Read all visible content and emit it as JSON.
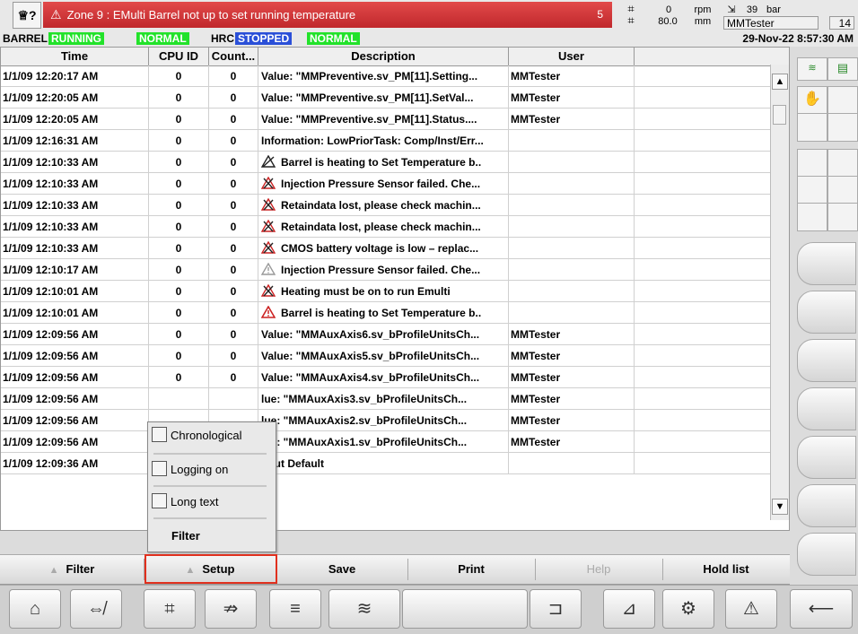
{
  "alarm": {
    "user_icon": "♕?",
    "text": "Zone 9 : EMulti Barrel not up to set running temperature",
    "count": "5"
  },
  "top_right": {
    "val1": "0",
    "val2": "80.0",
    "rpm": "rpm",
    "mm": "mm",
    "press_val": "39",
    "bar": "bar",
    "user": "MMTester",
    "num": "14"
  },
  "status": {
    "barrel": "BARREL",
    "running": "RUNNING",
    "normal1": "NORMAL",
    "hrc": "HRC",
    "stopped": "STOPPED",
    "normal2": "NORMAL",
    "datetime": "29-Nov-22 8:57:30 AM"
  },
  "table": {
    "headers": [
      "Time",
      "CPU ID",
      "Count...",
      "Description",
      "User"
    ],
    "rows": [
      {
        "time": "1/1/09 12:20:17 AM",
        "cpu": "0",
        "count": "0",
        "icon": "",
        "desc": "Value: \"MMPreventive.sv_PM[11].Setting...",
        "user": "MMTester"
      },
      {
        "time": "1/1/09 12:20:05 AM",
        "cpu": "0",
        "count": "0",
        "icon": "",
        "desc": "Value: \"MMPreventive.sv_PM[11].SetVal...",
        "user": "MMTester"
      },
      {
        "time": "1/1/09 12:20:05 AM",
        "cpu": "0",
        "count": "0",
        "icon": "",
        "desc": "Value: \"MMPreventive.sv_PM[11].Status....",
        "user": "MMTester"
      },
      {
        "time": "1/1/09 12:16:31 AM",
        "cpu": "0",
        "count": "0",
        "icon": "",
        "desc": "Information: LowPriorTask: Comp/Inst/Err...",
        "user": ""
      },
      {
        "time": "1/1/09 12:10:33 AM",
        "cpu": "0",
        "count": "0",
        "icon": "ack",
        "desc": "Barrel is heating to Set Temperature b..",
        "user": ""
      },
      {
        "time": "1/1/09 12:10:33 AM",
        "cpu": "0",
        "count": "0",
        "icon": "alarm",
        "desc": "Injection Pressure Sensor failed. Che...",
        "user": ""
      },
      {
        "time": "1/1/09 12:10:33 AM",
        "cpu": "0",
        "count": "0",
        "icon": "alarm",
        "desc": "Retaindata lost, please check machin...",
        "user": ""
      },
      {
        "time": "1/1/09 12:10:33 AM",
        "cpu": "0",
        "count": "0",
        "icon": "alarm",
        "desc": "Retaindata lost, please check machin...",
        "user": ""
      },
      {
        "time": "1/1/09 12:10:33 AM",
        "cpu": "0",
        "count": "0",
        "icon": "alarm",
        "desc": "CMOS battery voltage is low – replac...",
        "user": ""
      },
      {
        "time": "1/1/09 12:10:17 AM",
        "cpu": "0",
        "count": "0",
        "icon": "grey",
        "desc": "Injection Pressure Sensor failed. Che...",
        "user": ""
      },
      {
        "time": "1/1/09 12:10:01 AM",
        "cpu": "0",
        "count": "0",
        "icon": "alarm",
        "desc": "Heating must be on to run Emulti",
        "user": ""
      },
      {
        "time": "1/1/09 12:10:01 AM",
        "cpu": "0",
        "count": "0",
        "icon": "red",
        "desc": "Barrel is heating to Set Temperature b..",
        "user": ""
      },
      {
        "time": "1/1/09 12:09:56 AM",
        "cpu": "0",
        "count": "0",
        "icon": "",
        "desc": "Value: \"MMAuxAxis6.sv_bProfileUnitsCh...",
        "user": "MMTester"
      },
      {
        "time": "1/1/09 12:09:56 AM",
        "cpu": "0",
        "count": "0",
        "icon": "",
        "desc": "Value: \"MMAuxAxis5.sv_bProfileUnitsCh...",
        "user": "MMTester"
      },
      {
        "time": "1/1/09 12:09:56 AM",
        "cpu": "0",
        "count": "0",
        "icon": "",
        "desc": "Value: \"MMAuxAxis4.sv_bProfileUnitsCh...",
        "user": "MMTester"
      },
      {
        "time": "1/1/09 12:09:56 AM",
        "cpu": "",
        "count": "",
        "icon": "",
        "desc": "lue: \"MMAuxAxis3.sv_bProfileUnitsCh...",
        "user": "MMTester"
      },
      {
        "time": "1/1/09 12:09:56 AM",
        "cpu": "",
        "count": "",
        "icon": "",
        "desc": "lue: \"MMAuxAxis2.sv_bProfileUnitsCh...",
        "user": "MMTester"
      },
      {
        "time": "1/1/09 12:09:56 AM",
        "cpu": "",
        "count": "",
        "icon": "",
        "desc": "lue: \"MMAuxAxis1.sv_bProfileUnitsCh...",
        "user": "MMTester"
      },
      {
        "time": "1/1/09 12:09:36 AM",
        "cpu": "",
        "count": "",
        "icon": "",
        "desc": "gout Default",
        "user": ""
      }
    ]
  },
  "popup": {
    "chronological": "Chronological",
    "logging": "Logging on",
    "longtext": "Long text",
    "filter": "Filter"
  },
  "softkeys": {
    "filter": "Filter",
    "setup": "Setup",
    "save": "Save",
    "print": "Print",
    "help": "Help",
    "holdlist": "Hold list"
  },
  "colors": {
    "alarm_red": "#d0343a",
    "running_green": "#22e22a",
    "stopped_blue": "#2a4fd8",
    "highlight": "#e0301e"
  }
}
